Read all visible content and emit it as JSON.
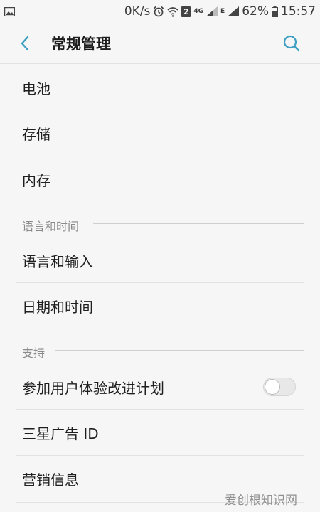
{
  "status_bar": {
    "net_speed": "0K/s",
    "sim_badge": "2",
    "net_4g": "4G",
    "net_e": "E",
    "battery": "62%",
    "time": "15:57"
  },
  "header": {
    "title": "常规管理",
    "back_icon": "chevron-left-icon",
    "search_icon": "search-icon",
    "accent_color": "#3d9fc4"
  },
  "items_top": [
    {
      "label": "电池"
    },
    {
      "label": "存储"
    },
    {
      "label": "内存"
    }
  ],
  "section_language": {
    "header": "语言和时间",
    "items": [
      {
        "label": "语言和输入"
      },
      {
        "label": "日期和时间"
      }
    ]
  },
  "section_support": {
    "header": "支持",
    "items": [
      {
        "label": "参加用户体验改进计划",
        "toggle": false
      },
      {
        "label": "三星广告 ID"
      },
      {
        "label": "营销信息"
      }
    ]
  },
  "watermark": "爱创根知识网"
}
